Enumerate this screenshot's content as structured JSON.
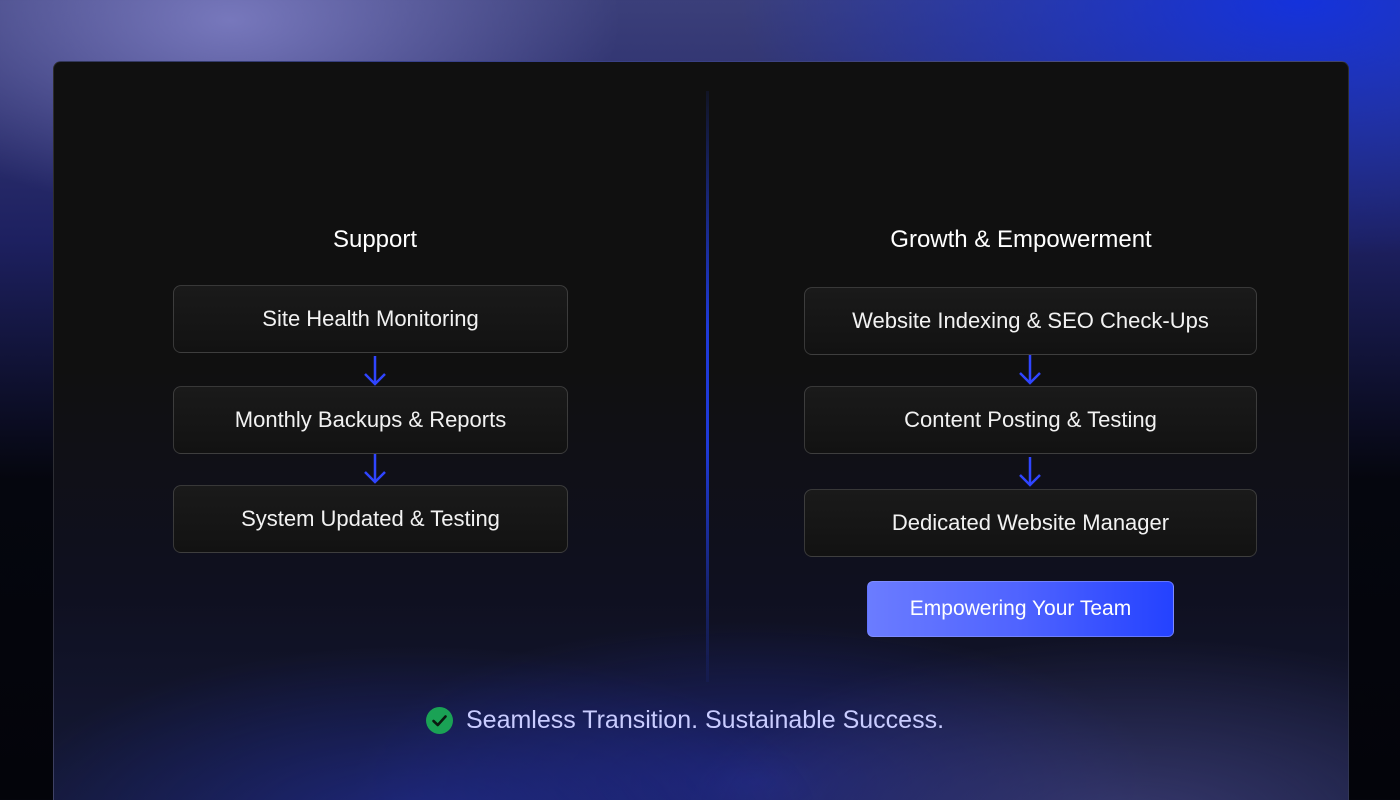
{
  "support": {
    "title": "Support",
    "steps": [
      "Site Health Monitoring",
      "Monthly Backups & Reports",
      "System Updated & Testing"
    ]
  },
  "growth": {
    "title": "Growth & Empowerment",
    "steps": [
      "Website Indexing & SEO Check-Ups",
      "Content Posting & Testing",
      "Dedicated Website Manager"
    ],
    "cta": "Empowering Your Team"
  },
  "tagline": {
    "text": "Seamless Transition. Sustainable Success.",
    "icon": "check-circle-icon"
  },
  "colors": {
    "arrow": "#2f45ff",
    "check": "#1aa255",
    "accent": "#2442ff"
  }
}
